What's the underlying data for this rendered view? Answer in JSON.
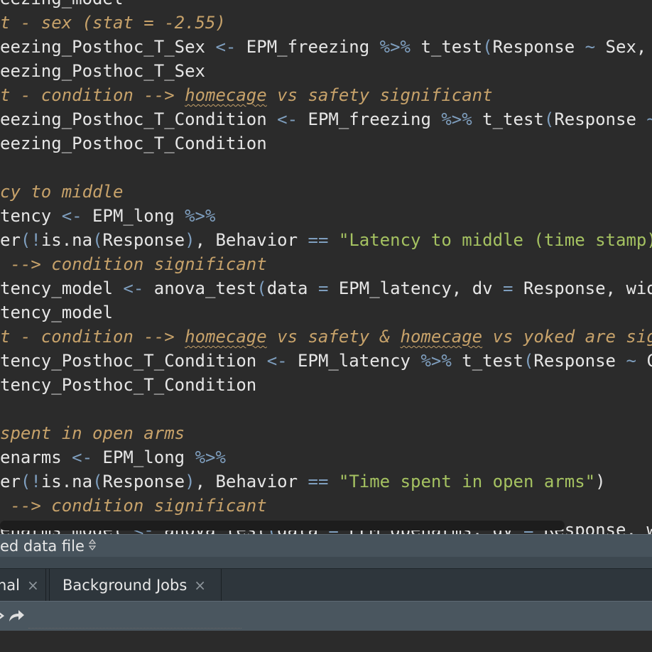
{
  "editor": {
    "lines": [
      [
        [
          "n",
          "eezing_model"
        ]
      ],
      [
        [
          "c",
          "t - sex (stat = -2.55)"
        ]
      ],
      [
        [
          "n",
          "eezing_Posthoc_T_Sex "
        ],
        [
          "op",
          "<-"
        ],
        [
          "n",
          " EPM_freezing "
        ],
        [
          "op",
          "%>%"
        ],
        [
          "n",
          " t_test"
        ],
        [
          "op",
          "("
        ],
        [
          "n",
          "Response "
        ],
        [
          "op",
          "~"
        ],
        [
          "n",
          " Sex, v"
        ]
      ],
      [
        [
          "n",
          "eezing_Posthoc_T_Sex"
        ]
      ],
      [
        [
          "c",
          "t - condition --> "
        ],
        [
          "cu",
          "homecage"
        ],
        [
          "c",
          " vs safety significant"
        ]
      ],
      [
        [
          "n",
          "eezing_Posthoc_T_Condition "
        ],
        [
          "op",
          "<-"
        ],
        [
          "n",
          " EPM_freezing "
        ],
        [
          "op",
          "%>%"
        ],
        [
          "n",
          " t_test"
        ],
        [
          "op",
          "("
        ],
        [
          "n",
          "Response "
        ],
        [
          "op",
          "~"
        ]
      ],
      [
        [
          "n",
          "eezing_Posthoc_T_Condition"
        ]
      ],
      [
        [
          "n",
          ""
        ]
      ],
      [
        [
          "c",
          "cy to middle"
        ]
      ],
      [
        [
          "n",
          "tency "
        ],
        [
          "op",
          "<-"
        ],
        [
          "n",
          " EPM_long "
        ],
        [
          "op",
          "%>%"
        ]
      ],
      [
        [
          "n",
          "er"
        ],
        [
          "op",
          "(!"
        ],
        [
          "n",
          "is.na"
        ],
        [
          "op",
          "("
        ],
        [
          "n",
          "Response"
        ],
        [
          "op",
          ")"
        ],
        [
          "n",
          ", Behavior "
        ],
        [
          "op",
          "=="
        ],
        [
          "n",
          " "
        ],
        [
          "str",
          "\"Latency to middle (time stamp)\""
        ]
      ],
      [
        [
          "c",
          " --> condition significant"
        ]
      ],
      [
        [
          "n",
          "tency_model "
        ],
        [
          "op",
          "<-"
        ],
        [
          "n",
          " anova_test"
        ],
        [
          "op",
          "("
        ],
        [
          "n",
          "data "
        ],
        [
          "op",
          "="
        ],
        [
          "n",
          " EPM_latency, dv "
        ],
        [
          "op",
          "="
        ],
        [
          "n",
          " Response, wid"
        ]
      ],
      [
        [
          "n",
          "tency_model"
        ]
      ],
      [
        [
          "c",
          "t - condition --> "
        ],
        [
          "cu",
          "homecage"
        ],
        [
          "c",
          " vs safety & "
        ],
        [
          "cu",
          "homecage"
        ],
        [
          "c",
          " vs yoked are sig"
        ]
      ],
      [
        [
          "n",
          "tency_Posthoc_T_Condition "
        ],
        [
          "op",
          "<-"
        ],
        [
          "n",
          " EPM_latency "
        ],
        [
          "op",
          "%>%"
        ],
        [
          "n",
          " t_test"
        ],
        [
          "op",
          "("
        ],
        [
          "n",
          "Response "
        ],
        [
          "op",
          "~"
        ],
        [
          "n",
          " Co"
        ]
      ],
      [
        [
          "n",
          "tency_Posthoc_T_Condition"
        ]
      ],
      [
        [
          "n",
          ""
        ]
      ],
      [
        [
          "c",
          "spent in open arms"
        ]
      ],
      [
        [
          "n",
          "enarms "
        ],
        [
          "op",
          "<-"
        ],
        [
          "n",
          " EPM_long "
        ],
        [
          "op",
          "%>%"
        ]
      ],
      [
        [
          "n",
          "er"
        ],
        [
          "op",
          "(!"
        ],
        [
          "n",
          "is.na"
        ],
        [
          "op",
          "("
        ],
        [
          "n",
          "Response"
        ],
        [
          "op",
          ")"
        ],
        [
          "n",
          ", Behavior "
        ],
        [
          "op",
          "=="
        ],
        [
          "n",
          " "
        ],
        [
          "str",
          "\"Time spent in open arms\""
        ],
        [
          "n",
          ")"
        ]
      ],
      [
        [
          "c",
          " --> condition significant"
        ]
      ],
      [
        [
          "n",
          "enarms_model "
        ],
        [
          "op",
          "<-"
        ],
        [
          "n",
          " anova_test"
        ],
        [
          "op",
          "("
        ],
        [
          "n",
          "data "
        ],
        [
          "op",
          "="
        ],
        [
          "n",
          " EPM_openarms, dv "
        ],
        [
          "op",
          "="
        ],
        [
          "n",
          " Response, wi"
        ]
      ]
    ]
  },
  "statusbar": {
    "file_type": "ed data file",
    "selector_icon": "updown-arrows-icon"
  },
  "tabs": [
    {
      "label": "nal",
      "close": "×"
    },
    {
      "label": "Background Jobs",
      "close": "×"
    }
  ],
  "toolbar": {
    "icons": [
      "back-arrow-icon",
      "forward-arrow-icon"
    ]
  },
  "colors": {
    "comment": "#c7a26a",
    "operator": "#7f9fbf",
    "string": "#a5c261",
    "text": "#e6e6e6",
    "background": "#2b2b2b"
  }
}
